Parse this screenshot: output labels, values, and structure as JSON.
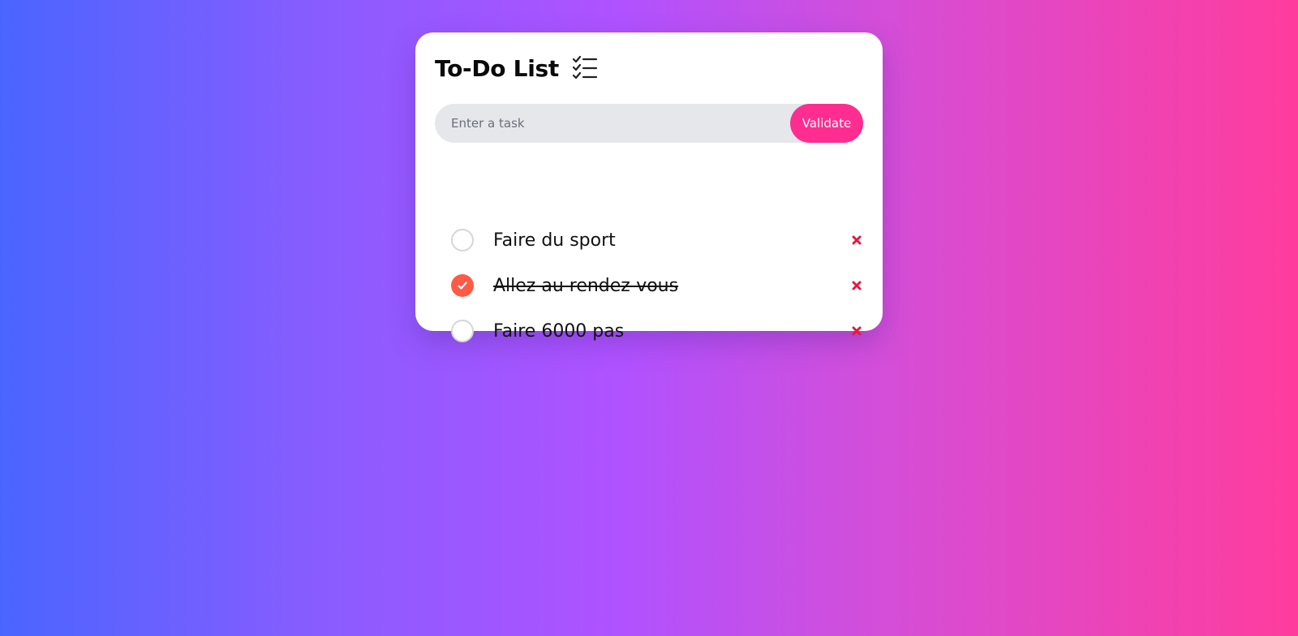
{
  "app": {
    "title": "To-Do List",
    "title_icon": "checklist-icon"
  },
  "input": {
    "placeholder": "Enter a task",
    "value": "",
    "submit_label": "Validate"
  },
  "tasks": [
    {
      "label": "Faire du sport",
      "completed": false
    },
    {
      "label": "Allez au rendez-vous",
      "completed": true
    },
    {
      "label": "Faire 6000 pas",
      "completed": false
    }
  ],
  "icons": {
    "checkbox": "check-icon",
    "delete": "close-icon"
  },
  "colors": {
    "accent": "#ff2d8f",
    "checked": "#ff5a45",
    "delete": "#e8173f",
    "input_background": "#e5e7eb"
  }
}
